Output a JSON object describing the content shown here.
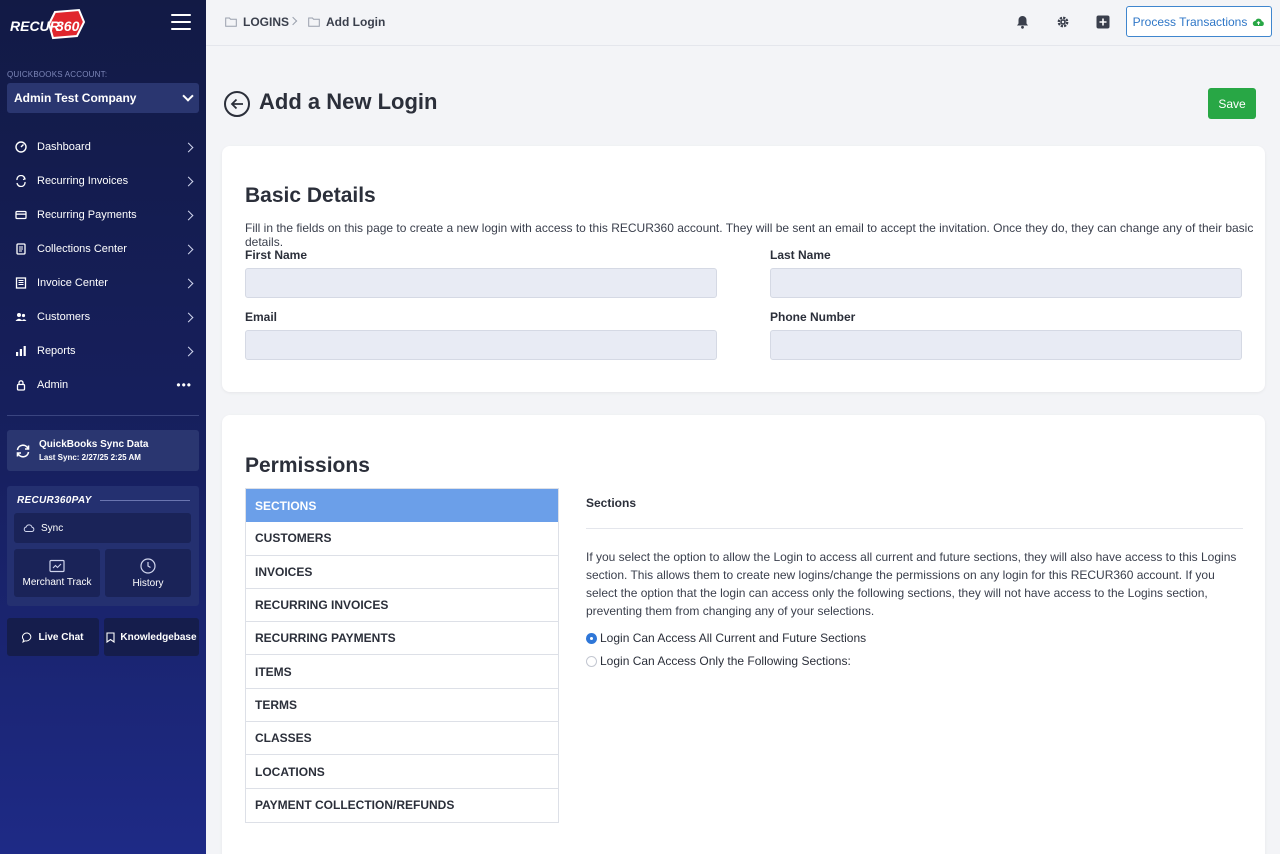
{
  "brand": {
    "logo_text": "RECUR",
    "logo_number": "360",
    "accent": "#e0262d"
  },
  "sidebar": {
    "account_label": "QUICKBOOKS ACCOUNT:",
    "company": "Admin Test Company",
    "items": [
      {
        "label": "Dashboard",
        "icon": "dashboard-icon"
      },
      {
        "label": "Recurring Invoices",
        "icon": "recurring-icon"
      },
      {
        "label": "Recurring Payments",
        "icon": "card-icon"
      },
      {
        "label": "Collections Center",
        "icon": "document-icon"
      },
      {
        "label": "Invoice Center",
        "icon": "invoice-icon"
      },
      {
        "label": "Customers",
        "icon": "users-icon"
      },
      {
        "label": "Reports",
        "icon": "bar-chart-icon"
      },
      {
        "label": "Admin",
        "icon": "lock-icon"
      }
    ],
    "sync": {
      "title": "QuickBooks Sync Data",
      "last_sync": "Last Sync: 2/27/25 2:25 AM"
    },
    "pay": {
      "title": "RECUR360PAY",
      "sync_label": "Sync",
      "merchant_label": "Merchant Track",
      "history_label": "History"
    },
    "live_chat": "Live Chat",
    "knowledgebase": "Knowledgebase"
  },
  "topbar": {
    "breadcrumb": [
      "LOGINS",
      "Add Login"
    ],
    "process_label": "Process Transactions"
  },
  "page": {
    "title": "Add a New Login",
    "save_label": "Save"
  },
  "basic": {
    "title": "Basic Details",
    "description": "Fill in the fields on this page to create a new login with access to this RECUR360 account. They will be sent an email to accept the invitation. Once they do, they can change any of their basic details.",
    "first_name_label": "First Name",
    "last_name_label": "Last Name",
    "email_label": "Email",
    "phone_label": "Phone Number"
  },
  "permissions": {
    "title": "Permissions",
    "sections": [
      "SECTIONS",
      "CUSTOMERS",
      "INVOICES",
      "RECURRING INVOICES",
      "RECURRING PAYMENTS",
      "ITEMS",
      "TERMS",
      "CLASSES",
      "LOCATIONS",
      "PAYMENT COLLECTION/REFUNDS"
    ],
    "active_section": "SECTIONS",
    "heading": "Sections",
    "description": "If you select the option to allow the Login to access all current and future sections, they will also have access to this Logins section. This allows them to create new logins/change the permissions on any login for this RECUR360 account. If you select the option that the login can access only the following sections, they will not have access to the Logins section, preventing them from changing any of your selections.",
    "option_all": "Login Can Access All Current and Future Sections",
    "option_only": "Login Can Access Only the Following Sections:",
    "selected_option": "all"
  }
}
